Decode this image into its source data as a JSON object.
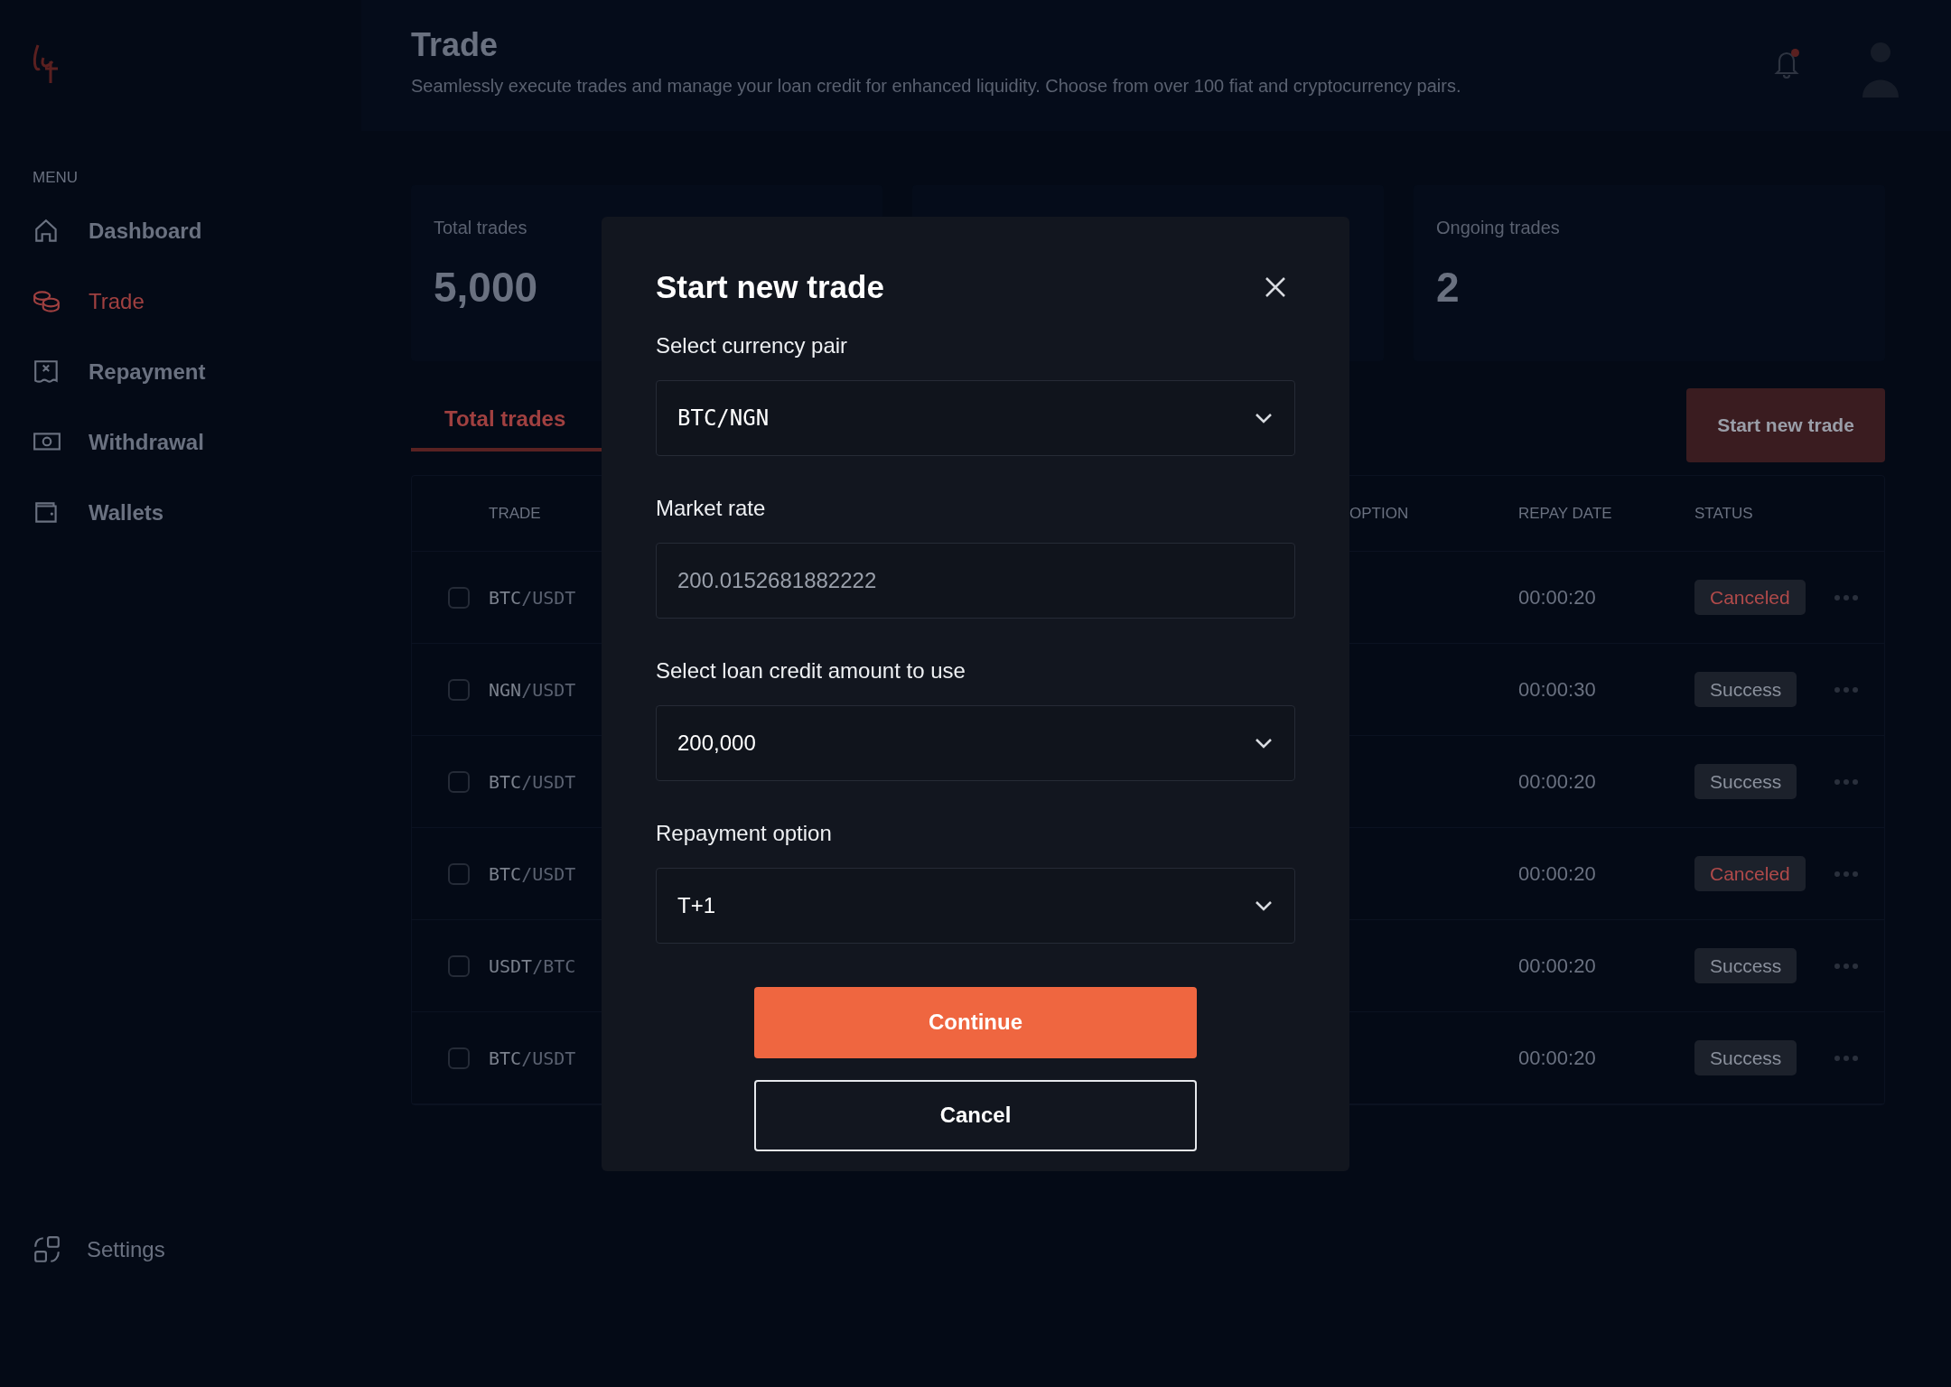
{
  "sidebar": {
    "menu_label": "MENU",
    "items": [
      {
        "label": "Dashboard",
        "selected": false,
        "kind": "home"
      },
      {
        "label": "Trade",
        "selected": true,
        "kind": "coins"
      },
      {
        "label": "Repayment",
        "selected": false,
        "kind": "receipt"
      },
      {
        "label": "Withdrawal",
        "selected": false,
        "kind": "cash"
      },
      {
        "label": "Wallets",
        "selected": false,
        "kind": "wallet"
      }
    ],
    "settings": {
      "label": "Settings"
    }
  },
  "header": {
    "title": "Trade",
    "subtitle": "Seamlessly execute trades and manage your loan credit for enhanced liquidity. Choose from over 100 fiat and cryptocurrency pairs.",
    "notification": true
  },
  "stats": [
    {
      "label": "Total trades",
      "value": "5,000"
    },
    {
      "label": "Ongoing trades",
      "value": "2"
    }
  ],
  "tabs": [
    {
      "label": "Total trades",
      "selected": true
    }
  ],
  "start_button": "Start new trade",
  "table": {
    "columns": [
      "TRADE",
      "OPTION",
      "REPAY DATE",
      "STATUS"
    ],
    "rows": [
      {
        "checked": false,
        "trade": "BTC/USDT",
        "repay_date": "00:00:20",
        "status": "Canceled",
        "kind": "canceled"
      },
      {
        "checked": false,
        "trade": "NGN/USDT",
        "repay_date": "00:00:30",
        "status": "Success",
        "kind": "success"
      },
      {
        "checked": false,
        "trade": "BTC/USDT",
        "repay_date": "00:00:20",
        "status": "Success",
        "kind": "success"
      },
      {
        "checked": false,
        "trade": "BTC/USDT",
        "repay_date": "00:00:20",
        "status": "Canceled",
        "kind": "canceled"
      },
      {
        "checked": false,
        "trade": "USDT/BTC",
        "repay_date": "00:00:20",
        "status": "Success",
        "kind": "success"
      },
      {
        "checked": false,
        "trade": "BTC/USDT",
        "repay_date": "00:00:20",
        "status": "Success",
        "kind": "success"
      }
    ]
  },
  "modal": {
    "title": "Start new trade",
    "fields": [
      {
        "label": "Select currency pair",
        "kind": "pair_select",
        "value": "BTC/NGN"
      },
      {
        "label": "Market rate",
        "kind": "readonly",
        "value": "200.0152681882222"
      },
      {
        "label": "Select loan credit amount to use",
        "kind": "select",
        "value": "200,000"
      },
      {
        "label": "Repayment option",
        "kind": "select",
        "value": "T+1"
      }
    ],
    "continue": "Continue",
    "cancel": "Cancel"
  }
}
